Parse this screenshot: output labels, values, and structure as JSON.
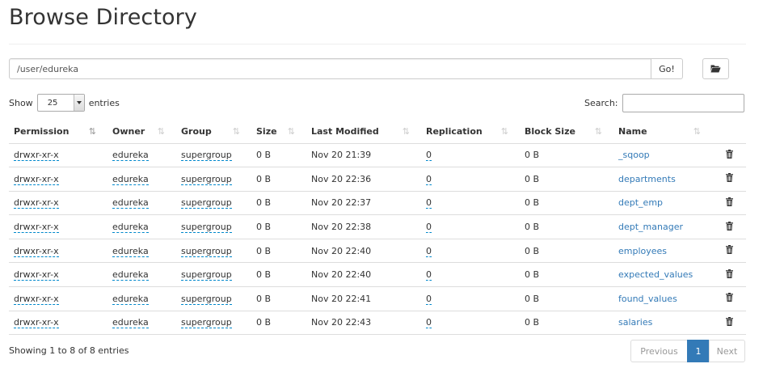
{
  "page": {
    "title": "Browse Directory"
  },
  "path": {
    "value": "/user/edureka",
    "go_label": "Go!"
  },
  "length": {
    "show_label": "Show",
    "selected": "25",
    "entries_label": "entries"
  },
  "search": {
    "label": "Search:"
  },
  "table": {
    "columns": [
      "Permission",
      "Owner",
      "Group",
      "Size",
      "Last Modified",
      "Replication",
      "Block Size",
      "Name"
    ],
    "rows": [
      {
        "permission": "drwxr-xr-x",
        "owner": "edureka",
        "group": "supergroup",
        "size": "0 B",
        "modified": "Nov 20 21:39",
        "replication": "0",
        "block_size": "0 B",
        "name": "_sqoop"
      },
      {
        "permission": "drwxr-xr-x",
        "owner": "edureka",
        "group": "supergroup",
        "size": "0 B",
        "modified": "Nov 20 22:36",
        "replication": "0",
        "block_size": "0 B",
        "name": "departments"
      },
      {
        "permission": "drwxr-xr-x",
        "owner": "edureka",
        "group": "supergroup",
        "size": "0 B",
        "modified": "Nov 20 22:37",
        "replication": "0",
        "block_size": "0 B",
        "name": "dept_emp"
      },
      {
        "permission": "drwxr-xr-x",
        "owner": "edureka",
        "group": "supergroup",
        "size": "0 B",
        "modified": "Nov 20 22:38",
        "replication": "0",
        "block_size": "0 B",
        "name": "dept_manager"
      },
      {
        "permission": "drwxr-xr-x",
        "owner": "edureka",
        "group": "supergroup",
        "size": "0 B",
        "modified": "Nov 20 22:40",
        "replication": "0",
        "block_size": "0 B",
        "name": "employees"
      },
      {
        "permission": "drwxr-xr-x",
        "owner": "edureka",
        "group": "supergroup",
        "size": "0 B",
        "modified": "Nov 20 22:40",
        "replication": "0",
        "block_size": "0 B",
        "name": "expected_values"
      },
      {
        "permission": "drwxr-xr-x",
        "owner": "edureka",
        "group": "supergroup",
        "size": "0 B",
        "modified": "Nov 20 22:41",
        "replication": "0",
        "block_size": "0 B",
        "name": "found_values"
      },
      {
        "permission": "drwxr-xr-x",
        "owner": "edureka",
        "group": "supergroup",
        "size": "0 B",
        "modified": "Nov 20 22:43",
        "replication": "0",
        "block_size": "0 B",
        "name": "salaries"
      }
    ]
  },
  "footer": {
    "info": "Showing 1 to 8 of 8 entries"
  },
  "pagination": {
    "previous": "Previous",
    "current": "1",
    "next": "Next"
  },
  "colors": {
    "link": "#337ab7",
    "active_page": "#337ab7",
    "border": "#dddddd"
  },
  "icons": {
    "folder": "folder-open-icon",
    "delete": "trash-icon",
    "sort": "sort-icon"
  }
}
